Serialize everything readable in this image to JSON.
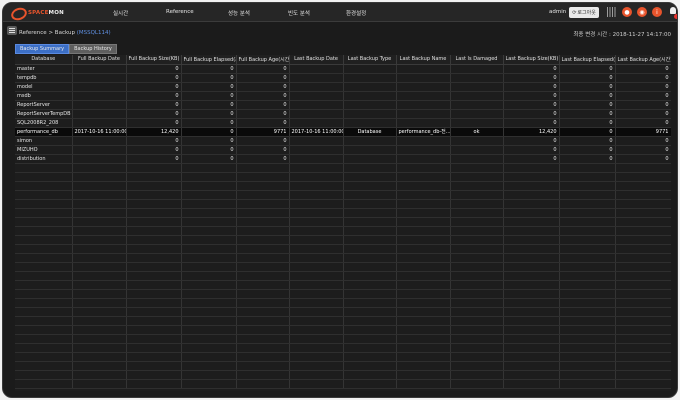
{
  "app": {
    "logo_part1": "SPACE",
    "logo_part2": "MON"
  },
  "nav": [
    "실시간",
    "Reference",
    "성능 분석",
    "빈도 분석",
    "환경설정"
  ],
  "user": {
    "name": "admin",
    "logout_label": "로그아웃"
  },
  "breadcrumb": {
    "path": "Reference > Backup ",
    "instance": "(MSSQL114)"
  },
  "last_change": "최종 변경 시간 : 2018-11-27 14:17:00",
  "tabs": [
    "Backup Summary",
    "Backup History"
  ],
  "active_tab": 0,
  "table": {
    "headers": [
      "Database",
      "Full Backup Date",
      "Full Backup Size(KB)",
      "Full Backup Elapsed(초)",
      "Full Backup Age(시간)",
      "Last Backup Date",
      "Last Backup Type",
      "Last Backup Name",
      "Last Is Damaged",
      "Last Backup Size(KB)",
      "Last Backup Elapsed(초)",
      "Last Backup Age(시간)"
    ],
    "rows": [
      [
        "master",
        "",
        "0",
        "0",
        "0",
        "",
        "",
        "",
        "",
        "0",
        "0",
        "0"
      ],
      [
        "tempdb",
        "",
        "0",
        "0",
        "0",
        "",
        "",
        "",
        "",
        "0",
        "0",
        "0"
      ],
      [
        "model",
        "",
        "0",
        "0",
        "0",
        "",
        "",
        "",
        "",
        "0",
        "0",
        "0"
      ],
      [
        "msdb",
        "",
        "0",
        "0",
        "0",
        "",
        "",
        "",
        "",
        "0",
        "0",
        "0"
      ],
      [
        "ReportServer",
        "",
        "0",
        "0",
        "0",
        "",
        "",
        "",
        "",
        "0",
        "0",
        "0"
      ],
      [
        "ReportServerTempDB",
        "",
        "0",
        "0",
        "0",
        "",
        "",
        "",
        "",
        "0",
        "0",
        "0"
      ],
      [
        "SQL2008R2_208",
        "",
        "0",
        "0",
        "0",
        "",
        "",
        "",
        "",
        "0",
        "0",
        "0"
      ],
      [
        "performance_db",
        "2017-10-16 11:00:00",
        "12,420",
        "0",
        "9771",
        "2017-10-16 11:00:00",
        "Database",
        "performance_db-전...",
        "ok",
        "12,420",
        "0",
        "9771"
      ],
      [
        "simon",
        "",
        "0",
        "0",
        "0",
        "",
        "",
        "",
        "",
        "0",
        "0",
        "0"
      ],
      [
        "MIZUHO",
        "",
        "0",
        "0",
        "0",
        "",
        "",
        "",
        "",
        "0",
        "0",
        "0"
      ],
      [
        "distribution",
        "",
        "0",
        "0",
        "0",
        "",
        "",
        "",
        "",
        "0",
        "0",
        "0"
      ]
    ],
    "selected_row": 7,
    "empty_rows": 25
  }
}
